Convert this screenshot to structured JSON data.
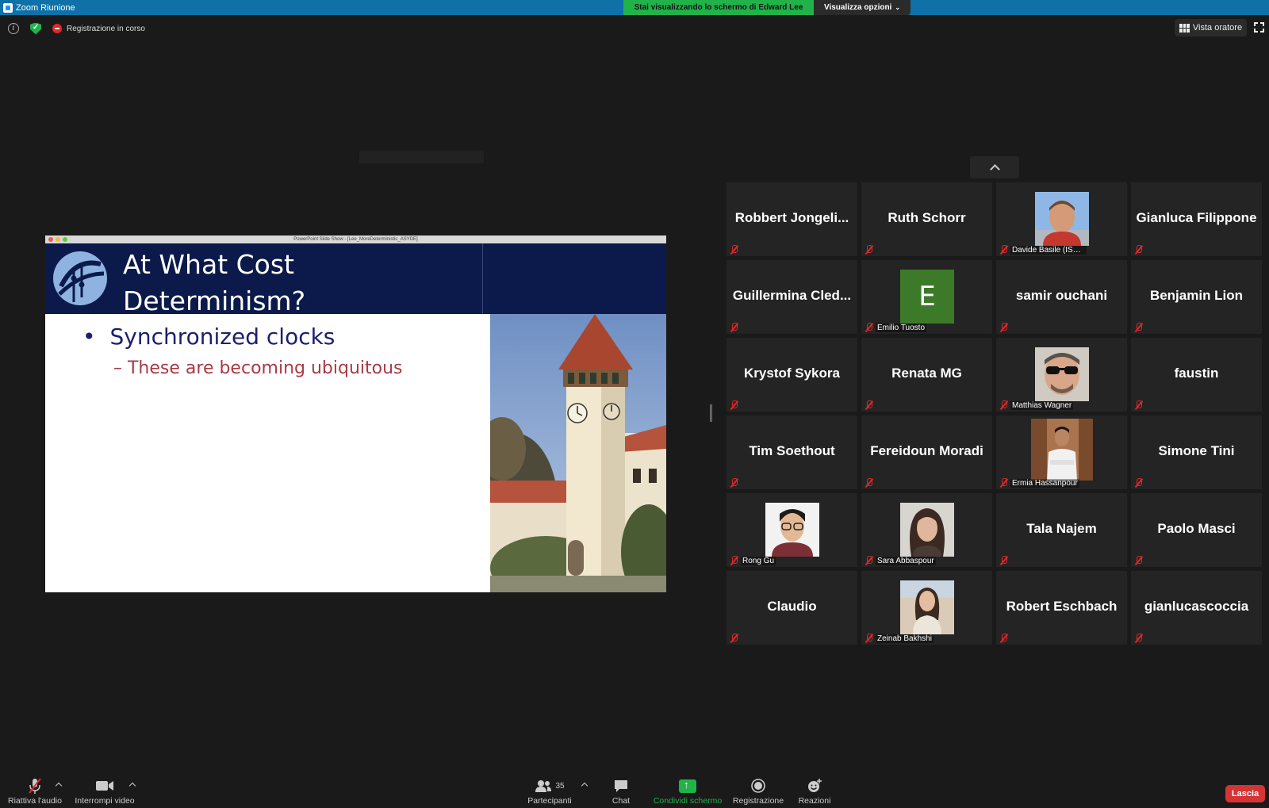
{
  "window": {
    "title": "Zoom Riunione"
  },
  "banner": {
    "sharing_text": "Stai visualizzando lo schermo di Edward Lee",
    "view_options": "Visualizza opzioni"
  },
  "meeting": {
    "recording_status": "Registrazione in corso",
    "speaker_view": "Vista oratore"
  },
  "slide": {
    "window_title": "PowerPoint Slide Show - [Lee_MoreDeterministic_ASYDE]",
    "title_line1": "At What Cost",
    "title_line2": "Determinism?",
    "bullet": "Synchronized clocks",
    "subbullet": "– These are becoming ubiquitous"
  },
  "participants_gallery": [
    {
      "name": "Robbert  Jongeli...",
      "video": false
    },
    {
      "name": "Ruth Schorr",
      "video": false
    },
    {
      "name": "Davide Basile (ISTI...",
      "video": true,
      "avatar": "photo-man-red-shirt"
    },
    {
      "name": "Gianluca Filippone",
      "video": false
    },
    {
      "name": "Guillermina  Cled...",
      "video": false
    },
    {
      "name": "Emilio Tuosto",
      "video": true,
      "letter": "E"
    },
    {
      "name": "samir ouchani",
      "video": false
    },
    {
      "name": "Benjamin Lion",
      "video": false
    },
    {
      "name": "Krystof Sykora",
      "video": false
    },
    {
      "name": "Renata MG",
      "video": false
    },
    {
      "name": "Matthias Wagner",
      "video": true,
      "avatar": "photo-man-sunglasses"
    },
    {
      "name": "faustin",
      "video": false
    },
    {
      "name": "Tim Soethout",
      "video": false
    },
    {
      "name": "Fereidoun Moradi",
      "video": false
    },
    {
      "name": "Ermia Hassanpour",
      "video": true,
      "avatar": "photo-man-white-shirt"
    },
    {
      "name": "Simone Tini",
      "video": false
    },
    {
      "name": "Rong Gu",
      "video": true,
      "avatar": "photo-man-glasses"
    },
    {
      "name": "Sara Abbaspour",
      "video": true,
      "avatar": "photo-woman"
    },
    {
      "name": "Tala Najem",
      "video": false
    },
    {
      "name": "Paolo Masci",
      "video": false
    },
    {
      "name": "Claudio",
      "video": false
    },
    {
      "name": "Zeinab Bakhshi",
      "video": true,
      "avatar": "photo-woman-outdoor"
    },
    {
      "name": "Robert Eschbach",
      "video": false
    },
    {
      "name": "gianlucascoccia",
      "video": false
    }
  ],
  "toolbar": {
    "unmute": "Riattiva l'audio",
    "stop_video": "Interrompi video",
    "participants": "Partecipanti",
    "participants_count": "35",
    "chat": "Chat",
    "share_screen": "Condividi schermo",
    "record": "Registrazione",
    "reactions": "Reazioni",
    "leave": "Lascia"
  },
  "colors": {
    "titlebar": "#0e71a8",
    "share_green": "#21b24a",
    "leave_red": "#d63434",
    "slide_header": "#0b1a4a",
    "muted_red": "#e02828"
  }
}
